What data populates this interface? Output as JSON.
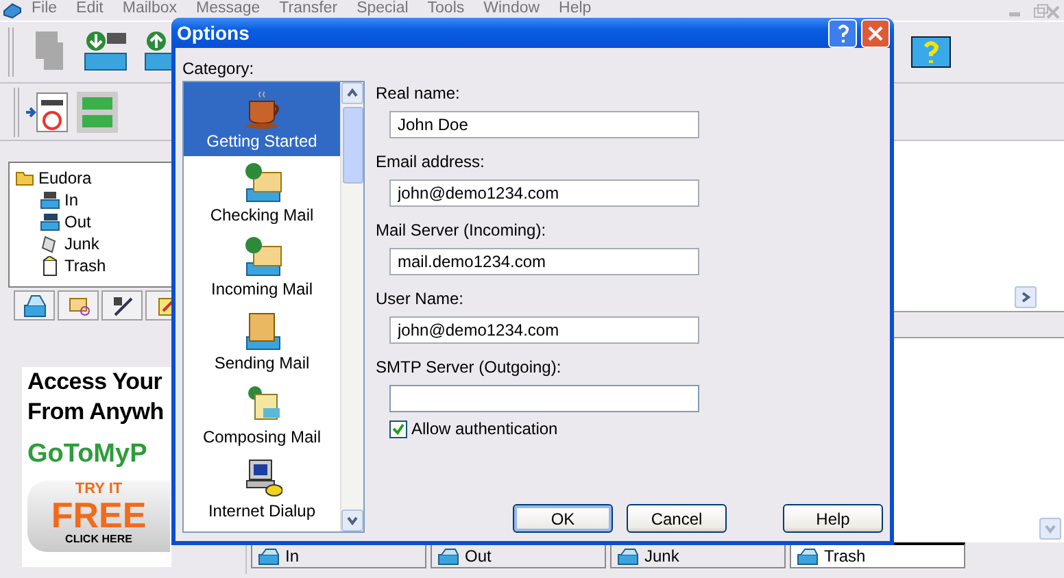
{
  "menu_bar": {
    "disabled": true,
    "items": [
      "File",
      "Edit",
      "Mailbox",
      "Message",
      "Transfer",
      "Special",
      "Tools",
      "Window",
      "Help"
    ]
  },
  "folder_tree": {
    "label": "Eudora",
    "children": [
      {
        "label": "In"
      },
      {
        "label": "Out"
      },
      {
        "label": "Junk"
      },
      {
        "label": "Trash"
      }
    ]
  },
  "ad": {
    "headline": [
      "Access Your",
      "From Anywh"
    ],
    "brand": "GoToMyP",
    "badge_top": "TRY IT",
    "badge_main": "FREE",
    "badge_bottom": "CLICK HERE"
  },
  "mailbox_tabs": [
    {
      "label": "In",
      "selected": false
    },
    {
      "label": "Out",
      "selected": false
    },
    {
      "label": "Junk",
      "selected": false
    },
    {
      "label": "Trash",
      "selected": true
    }
  ],
  "dialog": {
    "title": "Options",
    "category_label": "Category:",
    "categories": [
      {
        "label": "Getting Started",
        "selected": true
      },
      {
        "label": "Checking Mail",
        "selected": false
      },
      {
        "label": "Incoming Mail",
        "selected": false
      },
      {
        "label": "Sending Mail",
        "selected": false
      },
      {
        "label": "Composing Mail",
        "selected": false
      },
      {
        "label": "Internet Dialup",
        "selected": false
      }
    ],
    "fields": [
      {
        "label": "Real name:",
        "value": "John Doe",
        "focused": false
      },
      {
        "label": "Email address:",
        "value": "john@demo1234.com",
        "focused": false
      },
      {
        "label": "Mail Server (Incoming):",
        "value": "mail.demo1234.com",
        "focused": false
      },
      {
        "label": "User Name:",
        "value": "john@demo1234.com",
        "focused": false
      },
      {
        "label": "SMTP Server (Outgoing):",
        "focused": true
      }
    ],
    "checkbox": {
      "label": "Allow authentication",
      "checked": true
    },
    "buttons": [
      {
        "label": "OK",
        "default": true
      },
      {
        "label": "Cancel",
        "default": false
      },
      {
        "label": "Help",
        "default": false
      }
    ]
  }
}
